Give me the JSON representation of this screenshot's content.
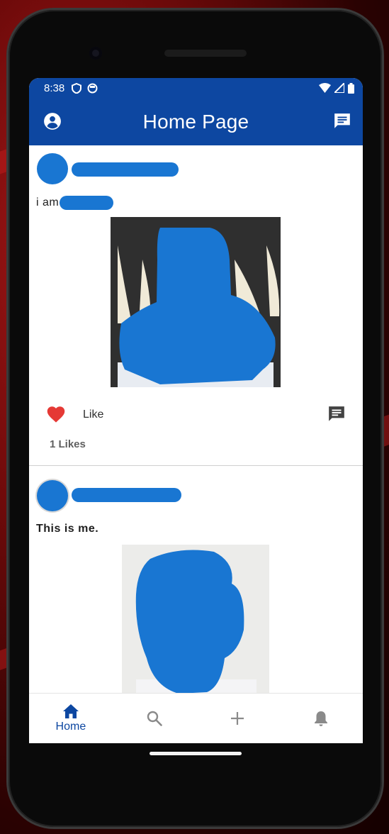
{
  "status_bar": {
    "time": "8:38"
  },
  "app_bar": {
    "title": "Home Page"
  },
  "posts": [
    {
      "caption": "i am",
      "likes_text": "1 Likes",
      "like_label": "Like"
    },
    {
      "caption": "This is me."
    }
  ],
  "bottom_nav": {
    "home_label": "Home"
  },
  "colors": {
    "primary": "#0d47a1",
    "accent_blob": "#1976d2",
    "heart": "#e53935",
    "icon_gray": "#424242"
  },
  "icons": [
    "account-circle-icon",
    "chat-icon",
    "heart-icon",
    "comment-icon",
    "home-icon",
    "search-icon",
    "add-icon",
    "bell-icon"
  ]
}
